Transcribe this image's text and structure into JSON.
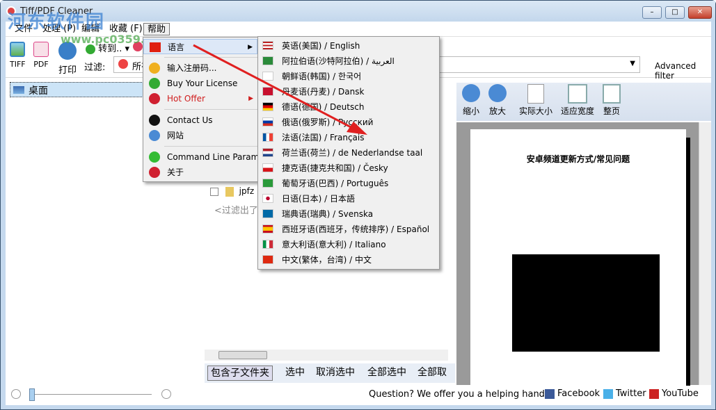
{
  "window": {
    "title": "Tiff/PDF Cleaner",
    "min": "–",
    "max": "□",
    "close": "✕"
  },
  "watermark": {
    "main": "河东软件园",
    "sub": "www.pc0359.cn"
  },
  "menubar": [
    "文件",
    "处理 (P)",
    "编辑",
    "收藏 (F)",
    "帮助"
  ],
  "toolbar": {
    "tiff": "TIFF",
    "pdf": "PDF",
    "print": "打印",
    "goto": "转到..",
    "filter_label": "过滤:",
    "filter_value": "所有",
    "advanced_filter": "Advanced filter"
  },
  "tree": {
    "selected": "桌面"
  },
  "filelist": {
    "items": [
      {
        "name": "jpfz"
      }
    ],
    "filtered_note": "<过滤出了一"
  },
  "bottom_buttons": [
    "包含子文件夹",
    "选中",
    "取消选中",
    "全部选中",
    "全部取"
  ],
  "viewer": {
    "buttons": [
      "缩小",
      "放大",
      "实际大小",
      "适应宽度",
      "整页"
    ],
    "doc_title": "安卓频道更新方式/常见问题"
  },
  "status": {
    "question": "Question? We offer you a helping hand -",
    "facebook": "Facebook",
    "twitter": "Twitter",
    "youtube": "YouTube"
  },
  "help_menu": [
    {
      "label": "语言",
      "icon": "cn-flag-icon",
      "submenu": true,
      "highlight": true
    },
    {
      "sep": true
    },
    {
      "label": "输入注册码...",
      "icon": "key-icon"
    },
    {
      "label": "Buy Your License",
      "icon": "dollar-icon"
    },
    {
      "label": "Hot Offer",
      "icon": "info-icon",
      "submenu": true,
      "color": "#d01c1c"
    },
    {
      "sep": true
    },
    {
      "label": "Contact Us",
      "icon": "mail-icon"
    },
    {
      "label": "网站",
      "icon": "globe-icon"
    },
    {
      "sep": true
    },
    {
      "label": "Command Line Params",
      "icon": "cmd-icon"
    },
    {
      "label": "关于",
      "icon": "info-icon"
    }
  ],
  "languages": [
    {
      "label": "英语(美国) / English",
      "flag": "us"
    },
    {
      "label": "阿拉伯语(沙特阿拉伯) / العربية",
      "flag": "sa"
    },
    {
      "label": "朝鲜语(韩国) / 한국어",
      "flag": "kr"
    },
    {
      "label": "丹麦语(丹麦) / Dansk",
      "flag": "dk"
    },
    {
      "label": "德语(德国) / Deutsch",
      "flag": "de"
    },
    {
      "label": "俄语(俄罗斯) / Русский",
      "flag": "ru"
    },
    {
      "label": "法语(法国) / Français",
      "flag": "fr"
    },
    {
      "label": "荷兰语(荷兰) / de Nederlandse taal",
      "flag": "nl"
    },
    {
      "label": "捷克语(捷克共和国) / Česky",
      "flag": "cz"
    },
    {
      "label": "葡萄牙语(巴西) / Português",
      "flag": "br"
    },
    {
      "label": "日语(日本) / 日本語",
      "flag": "jp"
    },
    {
      "label": "瑞典语(瑞典) / Svenska",
      "flag": "se"
    },
    {
      "label": "西班牙语(西班牙，传统排序) / Español",
      "flag": "es"
    },
    {
      "label": "意大利语(意大利) / Italiano",
      "flag": "it"
    },
    {
      "label": "中文(繁体，台湾) / 中文",
      "flag": "cn"
    }
  ]
}
